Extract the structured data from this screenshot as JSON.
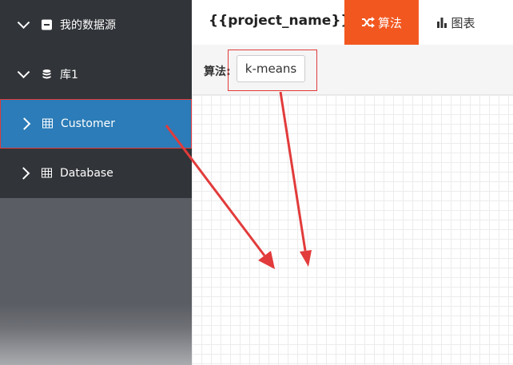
{
  "sidebar": {
    "items": [
      {
        "label": "我的数据源",
        "icon": "minus-square-icon",
        "expanded": true
      },
      {
        "label": "库1",
        "icon": "database-icon",
        "expanded": true
      },
      {
        "label": "Customer",
        "icon": "table-icon",
        "expanded": false,
        "selected": true
      },
      {
        "label": "Database",
        "icon": "table-icon",
        "expanded": false
      }
    ]
  },
  "header": {
    "project_name": "{{project_name}}",
    "tabs": [
      {
        "label": "算法",
        "icon": "shuffle-icon",
        "active": true
      },
      {
        "label": "图表",
        "icon": "bar-chart-icon",
        "active": false
      }
    ]
  },
  "algorithm": {
    "label": "算法:",
    "value": "k-means"
  },
  "colors": {
    "accent": "#f2571f",
    "selected": "#2b7cb8",
    "annotation": "#e23b3b"
  }
}
